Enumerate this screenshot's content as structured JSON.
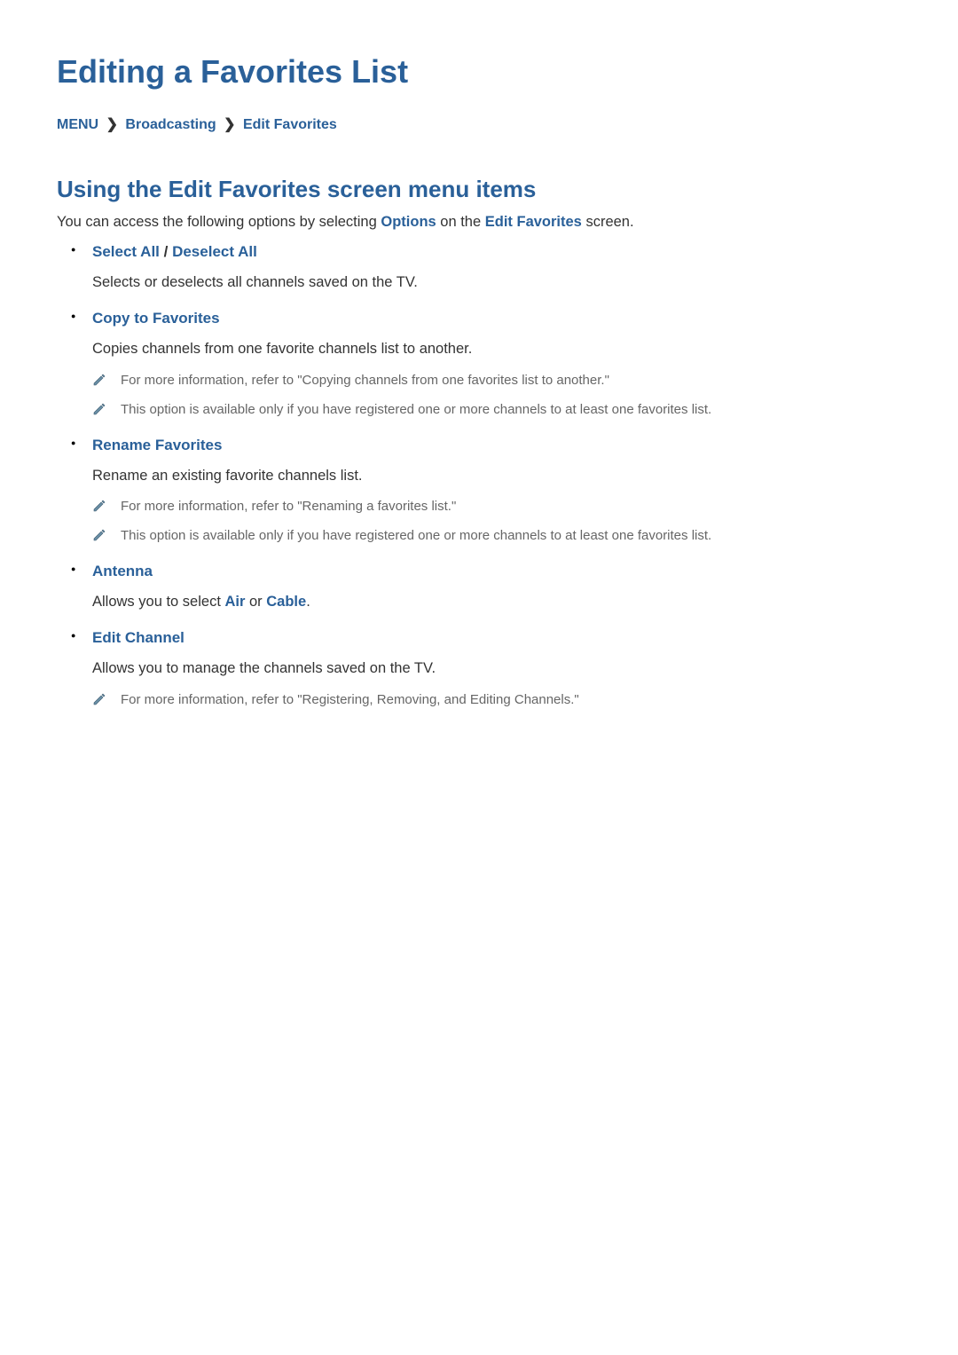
{
  "page_title": "Editing a Favorites List",
  "breadcrumb": {
    "item1": "MENU",
    "item2": "Broadcasting",
    "item3": "Edit Favorites"
  },
  "section_title": "Using the Edit Favorites screen menu items",
  "intro": {
    "pre": "You can access the following options by selecting ",
    "options_word": "Options",
    "mid": " on the ",
    "screen_word": "Edit Favorites",
    "post": " screen."
  },
  "options": [
    {
      "title_a": "Select All",
      "sep": " / ",
      "title_b": "Deselect All",
      "desc": "Selects or deselects all channels saved on the TV.",
      "notes": []
    },
    {
      "title_a": "Copy to Favorites",
      "desc": "Copies channels from one favorite channels list to another.",
      "notes": [
        "For more information, refer to \"Copying channels from one favorites list to another.\"",
        "This option is available only if you have registered one or more channels to at least one favorites list."
      ]
    },
    {
      "title_a": "Rename Favorites",
      "desc": "Rename an existing favorite channels list.",
      "notes": [
        "For more information, refer to \"Renaming a favorites list.\"",
        "This option is available only if you have registered one or more channels to at least one favorites list."
      ]
    },
    {
      "title_a": "Antenna",
      "desc_pre": "Allows you to select ",
      "desc_a": "Air",
      "desc_mid": " or ",
      "desc_b": "Cable",
      "desc_post": ".",
      "notes": []
    },
    {
      "title_a": "Edit Channel",
      "desc": "Allows you to manage the channels saved on the TV.",
      "notes": [
        "For more information, refer to \"Registering, Removing, and Editing Channels.\""
      ]
    }
  ]
}
